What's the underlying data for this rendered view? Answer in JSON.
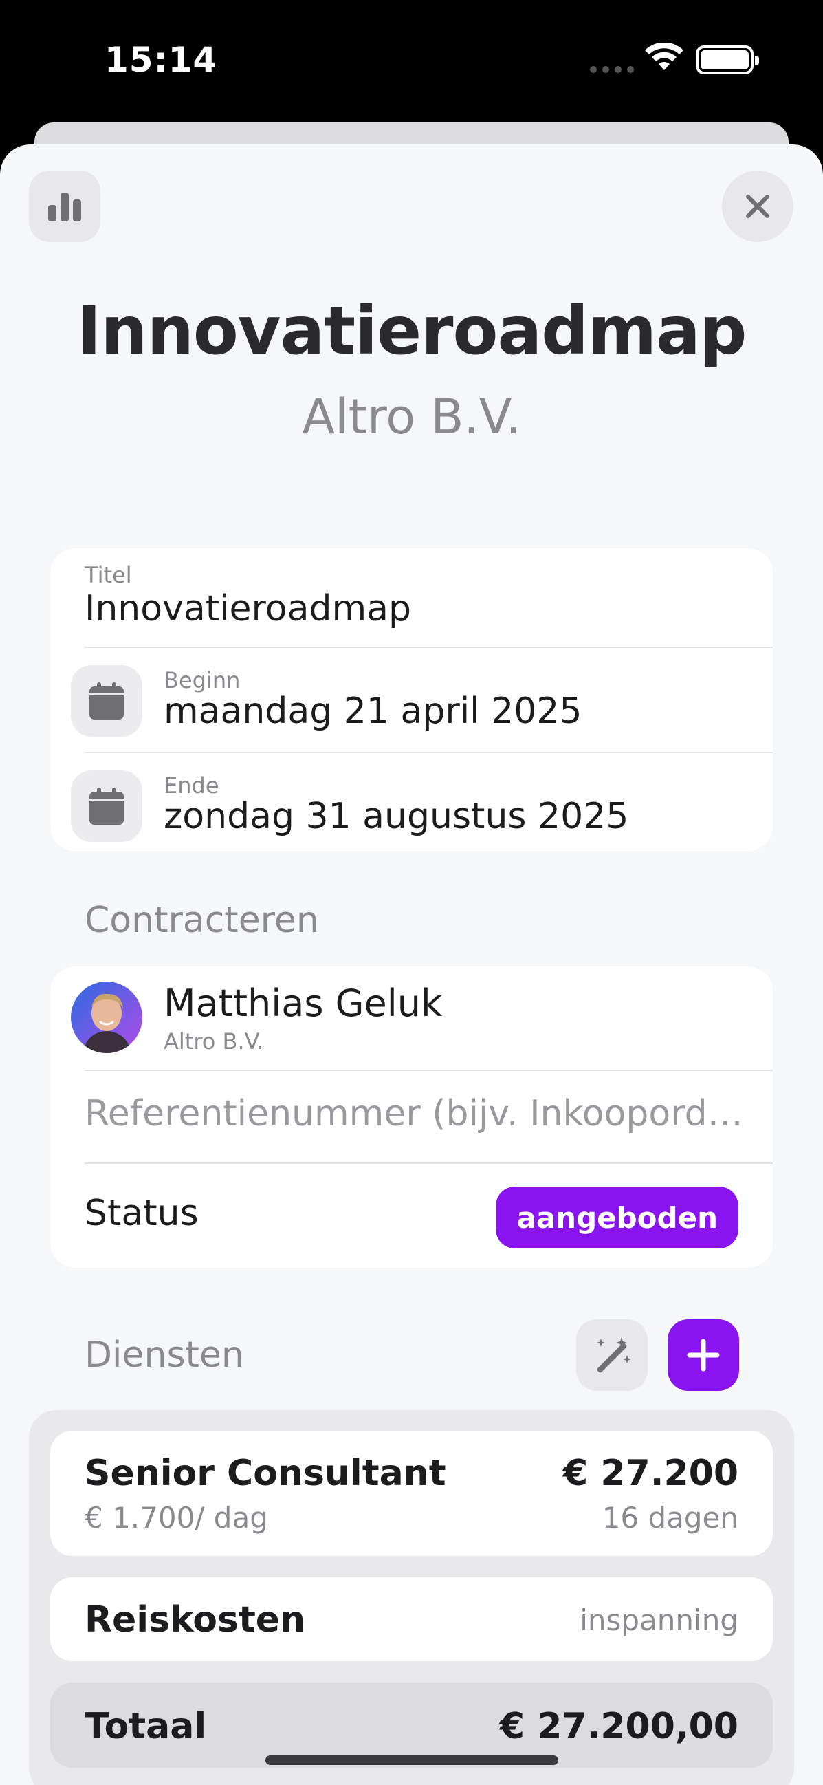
{
  "status_bar": {
    "time": "15:14"
  },
  "header": {
    "chart_icon": "bar-chart-icon",
    "close_icon": "close-icon",
    "title": "Innovatieroadmap",
    "subtitle": "Altro B.V."
  },
  "details": {
    "title_label": "Titel",
    "title_value": "Innovatieroadmap",
    "begin_label": "Beginn",
    "begin_value": "maandag 21 april 2025",
    "end_label": "Ende",
    "end_value": "zondag 31 augustus 2025"
  },
  "contract": {
    "section_label": "Contracteren",
    "contact_name": "Matthias Geluk",
    "contact_company": "Altro B.V.",
    "reference_placeholder": "Referentienummer (bijv. Inkooporder…",
    "status_label": "Status",
    "status_value": "aangeboden"
  },
  "services": {
    "section_label": "Diensten",
    "items": [
      {
        "name": "Senior Consultant",
        "rate": "€ 1.700/ dag",
        "amount": "€ 27.200",
        "days": "16 dagen"
      },
      {
        "name": "Reiskosten",
        "effort": "inspanning"
      }
    ],
    "total_label": "Totaal",
    "total_value": "€ 27.200,00"
  },
  "colors": {
    "accent": "#8a14f0",
    "background": "#f6f7f9",
    "muted_text": "#8a8a8e"
  }
}
